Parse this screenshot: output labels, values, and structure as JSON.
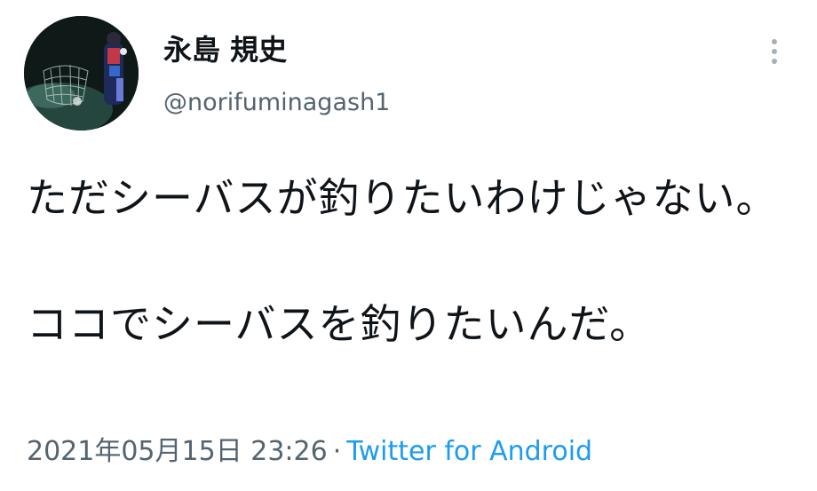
{
  "author": {
    "display_name": "永島 規史",
    "handle": "@norifuminagash1"
  },
  "tweet": {
    "paragraphs": [
      "ただシーバスが釣りたいわけじゃない。",
      "ココでシーバスを釣りたいんだ。"
    ]
  },
  "meta": {
    "timestamp": "2021年05月15日 23:26",
    "separator": "·",
    "source": "Twitter for Android"
  },
  "icons": {
    "more": "more-vertical-icon"
  },
  "colors": {
    "text": "#0f1419",
    "secondary": "#536471",
    "link": "#1d9bf0"
  }
}
